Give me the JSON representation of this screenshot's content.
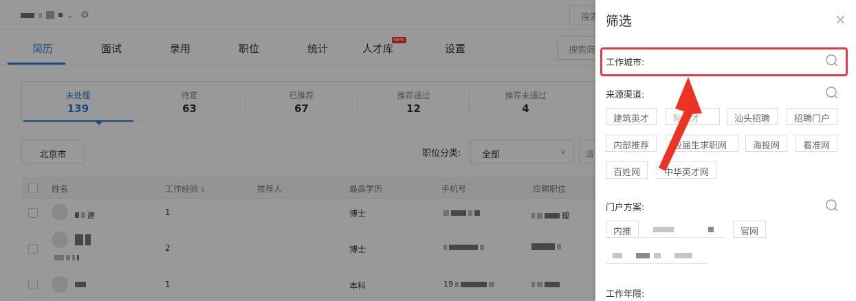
{
  "topbar": {
    "search_placeholder": "搜索"
  },
  "tabs": [
    {
      "label": "简历",
      "active": true
    },
    {
      "label": "面试"
    },
    {
      "label": "录用"
    },
    {
      "label": "职位"
    },
    {
      "label": "统计"
    },
    {
      "label": "人才库"
    },
    {
      "label": "设置"
    }
  ],
  "new_badge": "NEW",
  "tab_search_placeholder": "搜索简",
  "stats": [
    {
      "label": "未处理",
      "value": "139",
      "active": true
    },
    {
      "label": "待定",
      "value": "63"
    },
    {
      "label": "已推荐",
      "value": "67"
    },
    {
      "label": "推荐通过",
      "value": "12"
    },
    {
      "label": "推荐未通过",
      "value": "4"
    }
  ],
  "filters": {
    "city": "北京市",
    "category_label": "职位分类:",
    "category_value": "全部",
    "second_select": "请"
  },
  "table": {
    "headers": [
      "姓名",
      "工作经验",
      "推荐人",
      "最高学历",
      "手机号",
      "应聘职位"
    ],
    "rows": [
      {
        "experience": "1",
        "education": "博士",
        "name_suffix": "建",
        "job_suffix": "理"
      },
      {
        "experience": "2",
        "education": "博士"
      },
      {
        "experience": "1",
        "education": "本科",
        "phone_prefix": "19"
      }
    ]
  },
  "drawer": {
    "title": "筛选",
    "close_icon": "×",
    "city_label": "工作城市:",
    "source_label": "来源渠道:",
    "source_tags": [
      "建筑英才",
      "",
      "汕头招聘",
      "招聘门户",
      "内部推荐",
      "",
      "海投网",
      "看准网",
      "百姓网",
      "中华英才网"
    ],
    "source_partial": [
      "际人才",
      "应届生求职网"
    ],
    "portal_label": "门户方案:",
    "portal_tags": [
      "内推",
      "官网"
    ],
    "years_label": "工作年限:"
  },
  "colors": {
    "accent": "#2a7fd6",
    "highlight": "#e8394a",
    "arrow": "#ea3323"
  }
}
